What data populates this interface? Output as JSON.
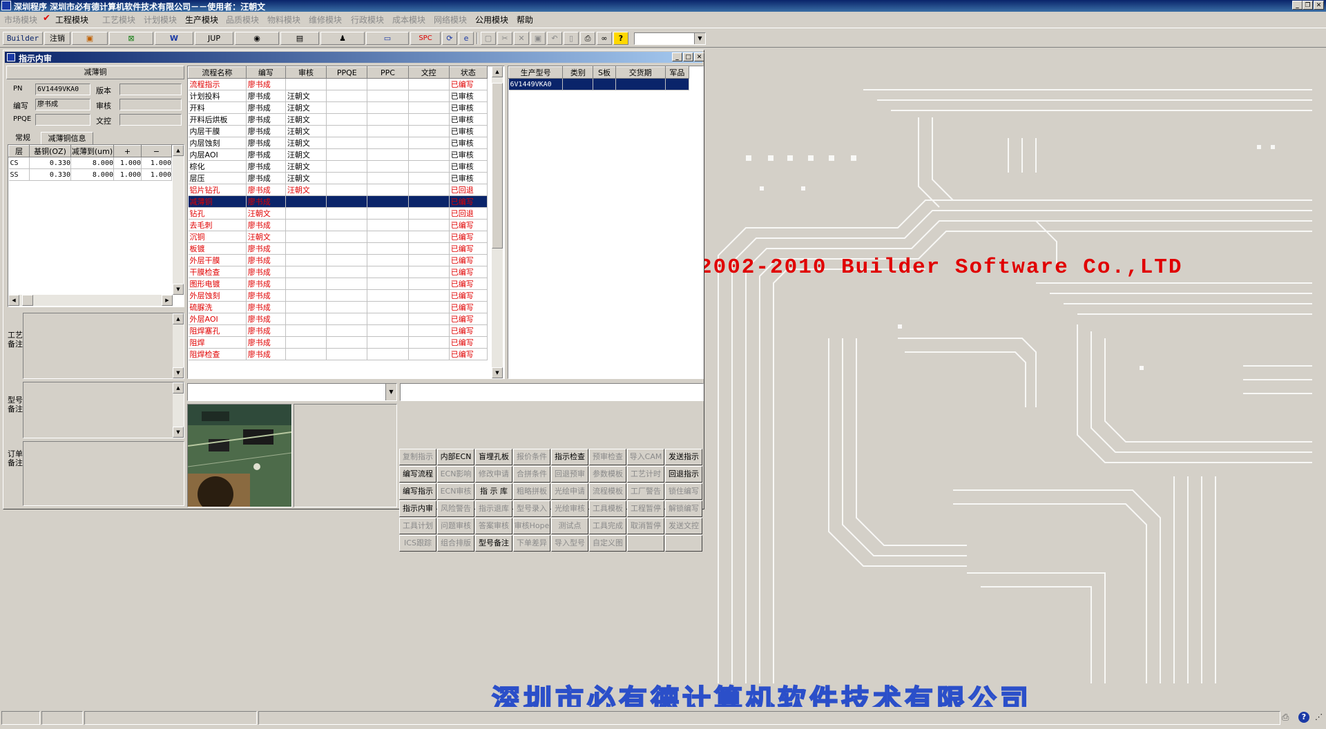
{
  "app": {
    "title": "深圳程序      深圳市必有德计算机软件技术有限公司－－使用者：汪朝文"
  },
  "menu": {
    "items": [
      {
        "label": "市场模块",
        "enabled": false
      },
      {
        "label": "工程模块",
        "enabled": true,
        "checked": true
      },
      {
        "label": "工艺模块",
        "enabled": false
      },
      {
        "label": "计划模块",
        "enabled": false
      },
      {
        "label": "生产模块",
        "enabled": true
      },
      {
        "label": "品质模块",
        "enabled": false
      },
      {
        "label": "物料模块",
        "enabled": false
      },
      {
        "label": "维修模块",
        "enabled": false
      },
      {
        "label": "行政模块",
        "enabled": false
      },
      {
        "label": "成本模块",
        "enabled": false
      },
      {
        "label": "网络模块",
        "enabled": false
      },
      {
        "label": "公用模块",
        "enabled": true
      },
      {
        "label": "帮助",
        "enabled": true
      }
    ]
  },
  "toolbar": {
    "builder": "Builder",
    "logout": "注销",
    "jup": "JUP",
    "spc": "SPC",
    "combo_value": ""
  },
  "window": {
    "title": "指示内审"
  },
  "left": {
    "section_title": "减薄铜",
    "pn_label": "PN",
    "pn_value": "6V1449VKA0",
    "version_label": "版本",
    "version_value": "",
    "author_label": "编写",
    "author_value": "廖书成",
    "reviewer_label": "审核",
    "reviewer_value": "",
    "ppqe_label": "PPQE",
    "ppqe_value": "",
    "dc_label": "文控",
    "dc_value": "",
    "tabs": [
      "常规",
      "减薄铜信息"
    ],
    "layer_table": {
      "headers": [
        "层",
        "基铜(OZ)",
        "减薄到(um)",
        "+",
        "−"
      ],
      "rows": [
        [
          "CS",
          "0.330",
          "8.000",
          "1.000",
          "1.000"
        ],
        [
          "SS",
          "0.330",
          "8.000",
          "1.000",
          "1.000"
        ]
      ]
    },
    "note_labels": {
      "process": "工艺备注",
      "model": "型号备注",
      "order": "订单备注"
    }
  },
  "flow_table": {
    "headers": [
      "流程名称",
      "编写",
      "审核",
      "PPQE",
      "PPC",
      "文控",
      "状态"
    ],
    "rows": [
      {
        "cells": [
          "流程指示",
          "廖书成",
          "",
          "",
          "",
          "",
          "已编写"
        ],
        "style": "red"
      },
      {
        "cells": [
          "计划投料",
          "廖书成",
          "汪朝文",
          "",
          "",
          "",
          "已审核"
        ],
        "style": ""
      },
      {
        "cells": [
          "开料",
          "廖书成",
          "汪朝文",
          "",
          "",
          "",
          "已审核"
        ],
        "style": ""
      },
      {
        "cells": [
          "开料后烘板",
          "廖书成",
          "汪朝文",
          "",
          "",
          "",
          "已审核"
        ],
        "style": ""
      },
      {
        "cells": [
          "内层干膜",
          "廖书成",
          "汪朝文",
          "",
          "",
          "",
          "已审核"
        ],
        "style": ""
      },
      {
        "cells": [
          "内层蚀刻",
          "廖书成",
          "汪朝文",
          "",
          "",
          "",
          "已审核"
        ],
        "style": ""
      },
      {
        "cells": [
          "内层AOI",
          "廖书成",
          "汪朝文",
          "",
          "",
          "",
          "已审核"
        ],
        "style": ""
      },
      {
        "cells": [
          "棕化",
          "廖书成",
          "汪朝文",
          "",
          "",
          "",
          "已审核"
        ],
        "style": ""
      },
      {
        "cells": [
          "层压",
          "廖书成",
          "汪朝文",
          "",
          "",
          "",
          "已审核"
        ],
        "style": ""
      },
      {
        "cells": [
          "铝片钻孔",
          "廖书成",
          "汪朝文",
          "",
          "",
          "",
          "已回退"
        ],
        "style": "red"
      },
      {
        "cells": [
          "减薄铜",
          "廖书成",
          "",
          "",
          "",
          "",
          "已编写"
        ],
        "style": "sel"
      },
      {
        "cells": [
          "钻孔",
          "汪朝文",
          "",
          "",
          "",
          "",
          "已回退"
        ],
        "style": "red"
      },
      {
        "cells": [
          "去毛刺",
          "廖书成",
          "",
          "",
          "",
          "",
          "已编写"
        ],
        "style": "red"
      },
      {
        "cells": [
          "沉铜",
          "汪朝文",
          "",
          "",
          "",
          "",
          "已编写"
        ],
        "style": "red"
      },
      {
        "cells": [
          "板镀",
          "廖书成",
          "",
          "",
          "",
          "",
          "已编写"
        ],
        "style": "red"
      },
      {
        "cells": [
          "外层干膜",
          "廖书成",
          "",
          "",
          "",
          "",
          "已编写"
        ],
        "style": "red"
      },
      {
        "cells": [
          "干膜检查",
          "廖书成",
          "",
          "",
          "",
          "",
          "已编写"
        ],
        "style": "red"
      },
      {
        "cells": [
          "图形电镀",
          "廖书成",
          "",
          "",
          "",
          "",
          "已编写"
        ],
        "style": "red"
      },
      {
        "cells": [
          "外层蚀刻",
          "廖书成",
          "",
          "",
          "",
          "",
          "已编写"
        ],
        "style": "red"
      },
      {
        "cells": [
          "硫脲洗",
          "廖书成",
          "",
          "",
          "",
          "",
          "已编写"
        ],
        "style": "red"
      },
      {
        "cells": [
          "外层AOI",
          "廖书成",
          "",
          "",
          "",
          "",
          "已编写"
        ],
        "style": "red"
      },
      {
        "cells": [
          "阻焊塞孔",
          "廖书成",
          "",
          "",
          "",
          "",
          "已编写"
        ],
        "style": "red"
      },
      {
        "cells": [
          "阻焊",
          "廖书成",
          "",
          "",
          "",
          "",
          "已编写"
        ],
        "style": "red"
      },
      {
        "cells": [
          "阻焊检查",
          "廖书成",
          "",
          "",
          "",
          "",
          "已编写"
        ],
        "style": "red"
      }
    ]
  },
  "model_table": {
    "headers": [
      "生产型号",
      "类别",
      "S板",
      "交货期",
      "军品"
    ],
    "rows": [
      [
        "6V1449VKA0",
        "",
        "",
        "",
        ""
      ]
    ]
  },
  "buttons": [
    [
      {
        "l": "复制指示",
        "e": false
      },
      {
        "l": "内部ECN",
        "e": true
      },
      {
        "l": "盲埋孔板",
        "e": true
      },
      {
        "l": "报价条件",
        "e": false
      },
      {
        "l": "指示检查",
        "e": true
      },
      {
        "l": "预审检查",
        "e": false
      },
      {
        "l": "导入CAM",
        "e": false
      },
      {
        "l": "发送指示",
        "e": true
      }
    ],
    [
      {
        "l": "编写流程",
        "e": true
      },
      {
        "l": "ECN影响",
        "e": false
      },
      {
        "l": "修改申请",
        "e": false
      },
      {
        "l": "合拼条件",
        "e": false
      },
      {
        "l": "回退预审",
        "e": false
      },
      {
        "l": "参数模板",
        "e": false
      },
      {
        "l": "工艺计时",
        "e": false
      },
      {
        "l": "回退指示",
        "e": true
      }
    ],
    [
      {
        "l": "编写指示",
        "e": true
      },
      {
        "l": "ECN审核",
        "e": false
      },
      {
        "l": "指 示 库",
        "e": true
      },
      {
        "l": "粗略拼板",
        "e": false
      },
      {
        "l": "光绘申请",
        "e": false
      },
      {
        "l": "流程模板",
        "e": false
      },
      {
        "l": "工厂警告",
        "e": false
      },
      {
        "l": "锁住编写",
        "e": false
      }
    ],
    [
      {
        "l": "指示内审",
        "e": true
      },
      {
        "l": "风险警告",
        "e": false
      },
      {
        "l": "指示退库",
        "e": false
      },
      {
        "l": "型号录入",
        "e": false
      },
      {
        "l": "光绘审核",
        "e": false
      },
      {
        "l": "工具模板",
        "e": false
      },
      {
        "l": "工程暂停",
        "e": false
      },
      {
        "l": "解锁编写",
        "e": false
      }
    ],
    [
      {
        "l": "工具计划",
        "e": false
      },
      {
        "l": "问题审核",
        "e": false
      },
      {
        "l": "答案审核",
        "e": false
      },
      {
        "l": "审核Hope",
        "e": false
      },
      {
        "l": "测试点",
        "e": false
      },
      {
        "l": "工具完成",
        "e": false
      },
      {
        "l": "取消暂停",
        "e": false
      },
      {
        "l": "发送文控",
        "e": false
      }
    ],
    [
      {
        "l": "ICS跟踪",
        "e": false
      },
      {
        "l": "组合排版",
        "e": false
      },
      {
        "l": "型号备注",
        "e": true
      },
      {
        "l": "下单差异",
        "e": false
      },
      {
        "l": "导入型号",
        "e": false
      },
      {
        "l": "自定义图",
        "e": false
      },
      {
        "l": "",
        "e": false
      },
      {
        "l": "",
        "e": false
      }
    ]
  ],
  "desktop": {
    "copyright": "2002-2010 Builder Software Co.,LTD",
    "company": "深圳市必有德计算机软件技术有限公司"
  },
  "colors": {
    "accent": "#0a246a",
    "status_red": "#e00000",
    "bg": "#d4d0c8"
  }
}
